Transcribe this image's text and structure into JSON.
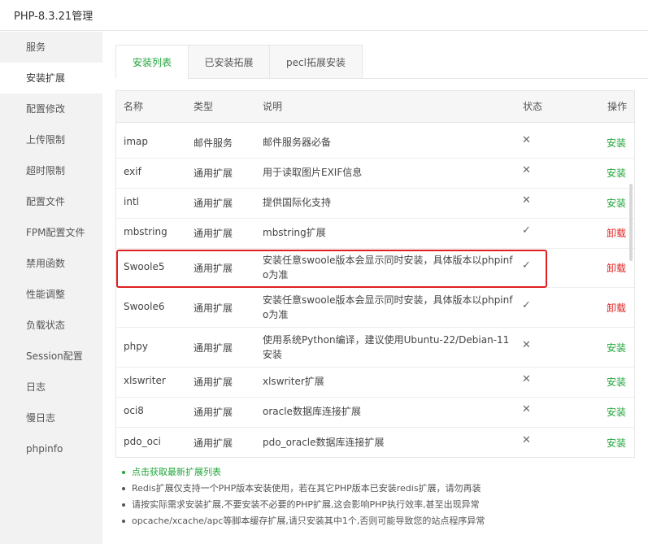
{
  "window": {
    "title": "PHP-8.3.21管理"
  },
  "sidebar": {
    "items": [
      {
        "label": "服务"
      },
      {
        "label": "安装扩展"
      },
      {
        "label": "配置修改"
      },
      {
        "label": "上传限制"
      },
      {
        "label": "超时限制"
      },
      {
        "label": "配置文件"
      },
      {
        "label": "FPM配置文件"
      },
      {
        "label": "禁用函数"
      },
      {
        "label": "性能调整"
      },
      {
        "label": "负载状态"
      },
      {
        "label": "Session配置"
      },
      {
        "label": "日志"
      },
      {
        "label": "慢日志"
      },
      {
        "label": "phpinfo"
      }
    ],
    "active": "安装扩展"
  },
  "tabs": [
    {
      "label": "安装列表"
    },
    {
      "label": "已安装拓展"
    },
    {
      "label": "pecl拓展安装"
    }
  ],
  "table": {
    "columns": [
      "名称",
      "类型",
      "说明",
      "状态",
      "操作"
    ],
    "rows": [
      {
        "name": "imap",
        "type": "邮件服务",
        "desc": "邮件服务器必备",
        "status": "✕",
        "action": "安装"
      },
      {
        "name": "exif",
        "type": "通用扩展",
        "desc": "用于读取图片EXIF信息",
        "status": "✕",
        "action": "安装"
      },
      {
        "name": "intl",
        "type": "通用扩展",
        "desc": "提供国际化支持",
        "status": "✕",
        "action": "安装"
      },
      {
        "name": "mbstring",
        "type": "通用扩展",
        "desc": "mbstring扩展",
        "status": "✓",
        "action": "卸载"
      },
      {
        "name": "Swoole5",
        "type": "通用扩展",
        "desc": "安装任意swoole版本会显示同时安装，具体版本以phpinfo为准",
        "status": "✓",
        "action": "卸载"
      },
      {
        "name": "Swoole6",
        "type": "通用扩展",
        "desc": "安装任意swoole版本会显示同时安装，具体版本以phpinfo为准",
        "status": "✓",
        "action": "卸载"
      },
      {
        "name": "phpy",
        "type": "通用扩展",
        "desc": "使用系统Python编译，建议使用Ubuntu-22/Debian-11安装",
        "status": "✕",
        "action": "安装"
      },
      {
        "name": "xlswriter",
        "type": "通用扩展",
        "desc": "xlswriter扩展",
        "status": "✕",
        "action": "安装"
      },
      {
        "name": "oci8",
        "type": "通用扩展",
        "desc": "oracle数据库连接扩展",
        "status": "✕",
        "action": "安装"
      },
      {
        "name": "pdo_oci",
        "type": "通用扩展",
        "desc": "pdo_oracle数据库连接扩展",
        "status": "✕",
        "action": "安装"
      }
    ]
  },
  "notes": [
    "点击获取最新扩展列表",
    "Redis扩展仅支持一个PHP版本安装使用，若在其它PHP版本已安装redis扩展，请勿再装",
    "请按实际需求安装扩展,不要安装不必要的PHP扩展,这会影响PHP执行效率,甚至出现异常",
    "opcache/xcache/apc等脚本缓存扩展,请只安装其中1个,否则可能导致您的站点程序异常"
  ],
  "colors": {
    "accent": "#20a53a",
    "danger": "#e02020"
  }
}
